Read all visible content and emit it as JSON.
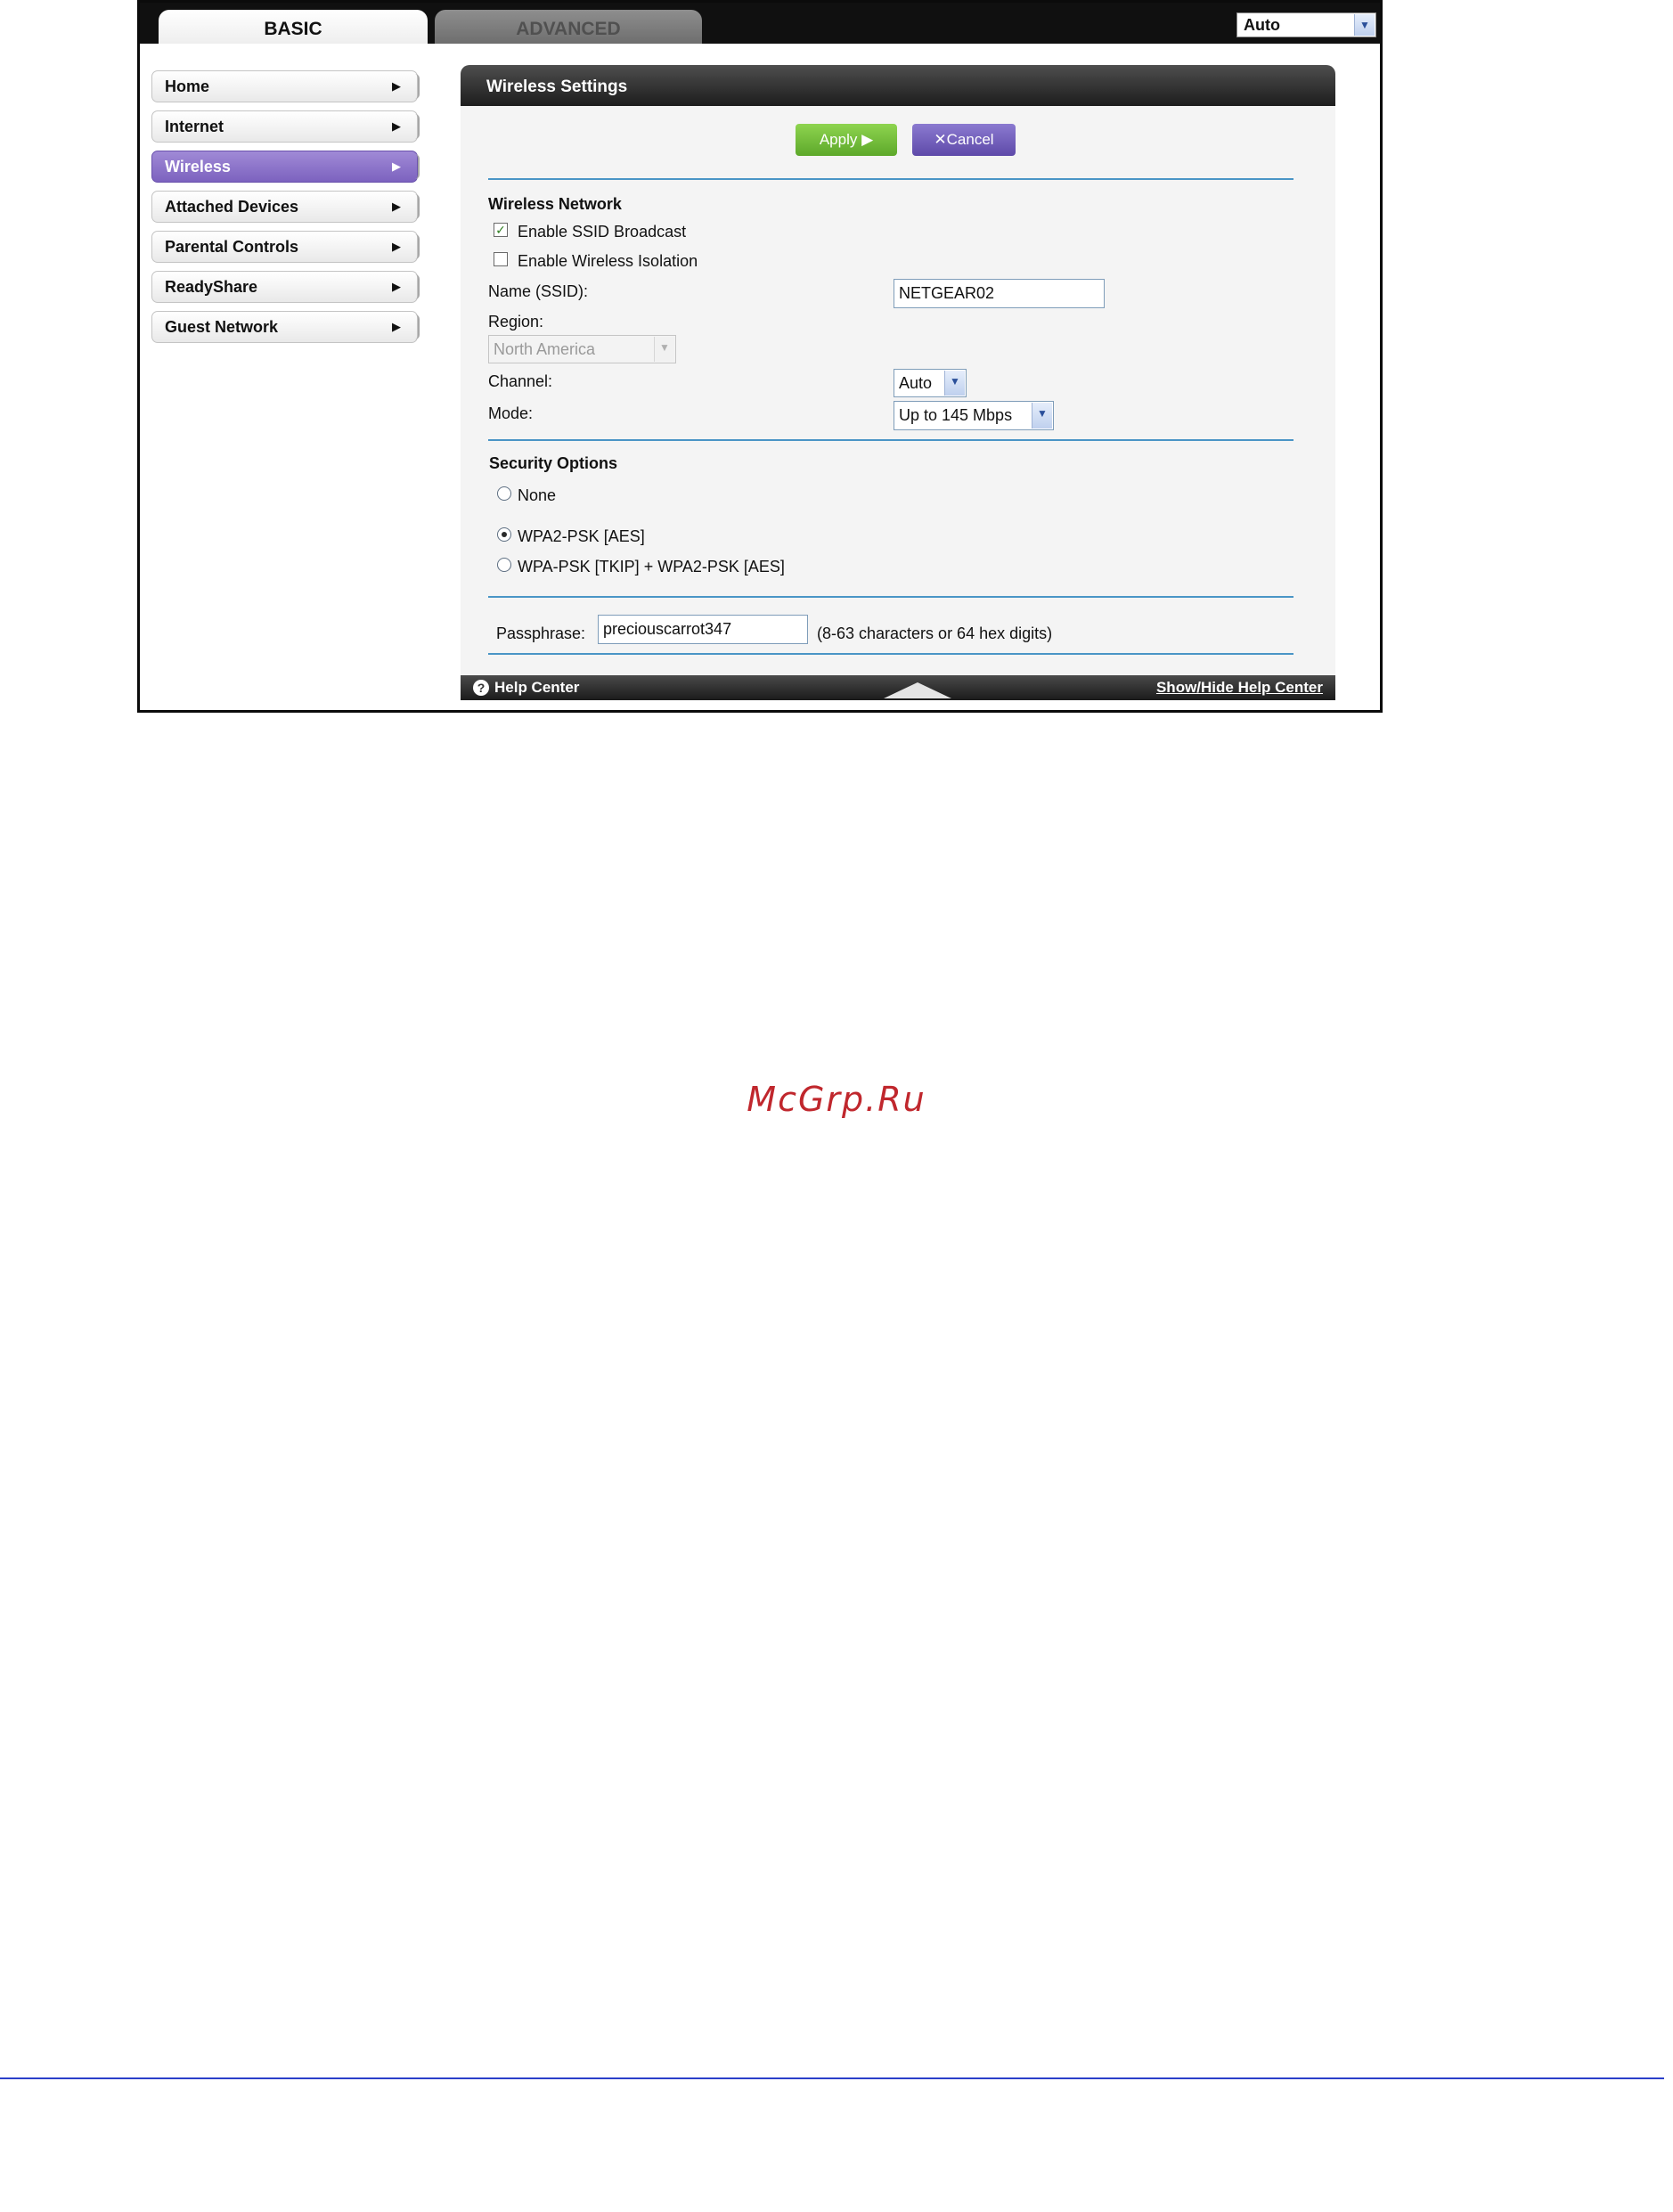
{
  "top_tabs": {
    "basic": "BASIC",
    "advanced": "ADVANCED"
  },
  "language_select": {
    "value": "Auto"
  },
  "sidebar": {
    "items": [
      {
        "label": "Home",
        "active": false
      },
      {
        "label": "Internet",
        "active": false
      },
      {
        "label": "Wireless",
        "active": true
      },
      {
        "label": "Attached Devices",
        "active": false
      },
      {
        "label": "Parental Controls",
        "active": false
      },
      {
        "label": "ReadyShare",
        "active": false
      },
      {
        "label": "Guest Network",
        "active": false
      }
    ]
  },
  "panel": {
    "title": "Wireless Settings",
    "apply_label": "Apply ▶",
    "cancel_label": "✕Cancel",
    "wireless_network": {
      "heading": "Wireless Network",
      "ssid_broadcast": {
        "label": "Enable SSID Broadcast",
        "checked": true
      },
      "wireless_isolation": {
        "label": "Enable Wireless Isolation",
        "checked": false
      },
      "name_label": "Name (SSID):",
      "name_value": "NETGEAR02",
      "region_label": "Region:",
      "region_value": "North America",
      "channel_label": "Channel:",
      "channel_value": "Auto",
      "mode_label": "Mode:",
      "mode_value": "Up to 145 Mbps"
    },
    "security_options": {
      "heading": "Security Options",
      "options": [
        {
          "label": "None",
          "selected": false
        },
        {
          "label": "WPA2-PSK [AES]",
          "selected": true
        },
        {
          "label": "WPA-PSK [TKIP] + WPA2-PSK [AES]",
          "selected": false
        }
      ],
      "passphrase_label": "Passphrase:",
      "passphrase_value": "preciouscarrot347",
      "passphrase_hint": "(8-63 characters or 64 hex digits)"
    },
    "footer": {
      "help_center": "Help Center",
      "show_hide": "Show/Hide Help Center"
    }
  },
  "page": {
    "watermark": "McGrp.Ru"
  },
  "colors": {
    "active_nav": "#7c62bf",
    "apply_button": "#5da82a",
    "cancel_button": "#5e4aa9",
    "separator": "#4a95c6",
    "watermark": "#c0272d",
    "page_rule": "#2b3fc9"
  }
}
